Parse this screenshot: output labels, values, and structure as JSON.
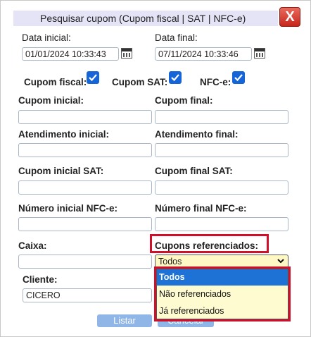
{
  "dialog": {
    "title": "Pesquisar cupom (Cupom fiscal | SAT | NFC-e)",
    "close_label": "X"
  },
  "dates": {
    "start_label": "Data inicial:",
    "start_value": "01/01/2024 10:33:43",
    "end_label": "Data final:",
    "end_value": "07/11/2024 10:33:46"
  },
  "types": {
    "fiscal_label": "Cupom fiscal:",
    "sat_label": "Cupom SAT:",
    "nfce_label": "NFC-e:",
    "fiscal_checked": true,
    "sat_checked": true,
    "nfce_checked": true
  },
  "fields": {
    "cupom_inicial": "Cupom inicial:",
    "cupom_final": "Cupom final:",
    "atendimento_inicial": "Atendimento inicial:",
    "atendimento_final": "Atendimento final:",
    "cupom_inicial_sat": "Cupom inicial SAT:",
    "cupom_final_sat": "Cupom final SAT:",
    "numero_inicial_nfce": "Número inicial NFC-e:",
    "numero_final_nfce": "Número final NFC-e:",
    "caixa": "Caixa:",
    "cupons_referenciados": "Cupons referenciados:",
    "cliente": "Cliente:",
    "cliente_value": "CICERO"
  },
  "referenciados": {
    "selected": "Todos",
    "options": [
      "Todos",
      "Não referenciados",
      "Já referenciados"
    ]
  },
  "buttons": {
    "listar": "Listar",
    "cancelar": "Cancelar"
  },
  "colors": {
    "highlight": "#d0102a",
    "accent": "#1e72d6",
    "dropdown_bg": "#fffbd0"
  }
}
